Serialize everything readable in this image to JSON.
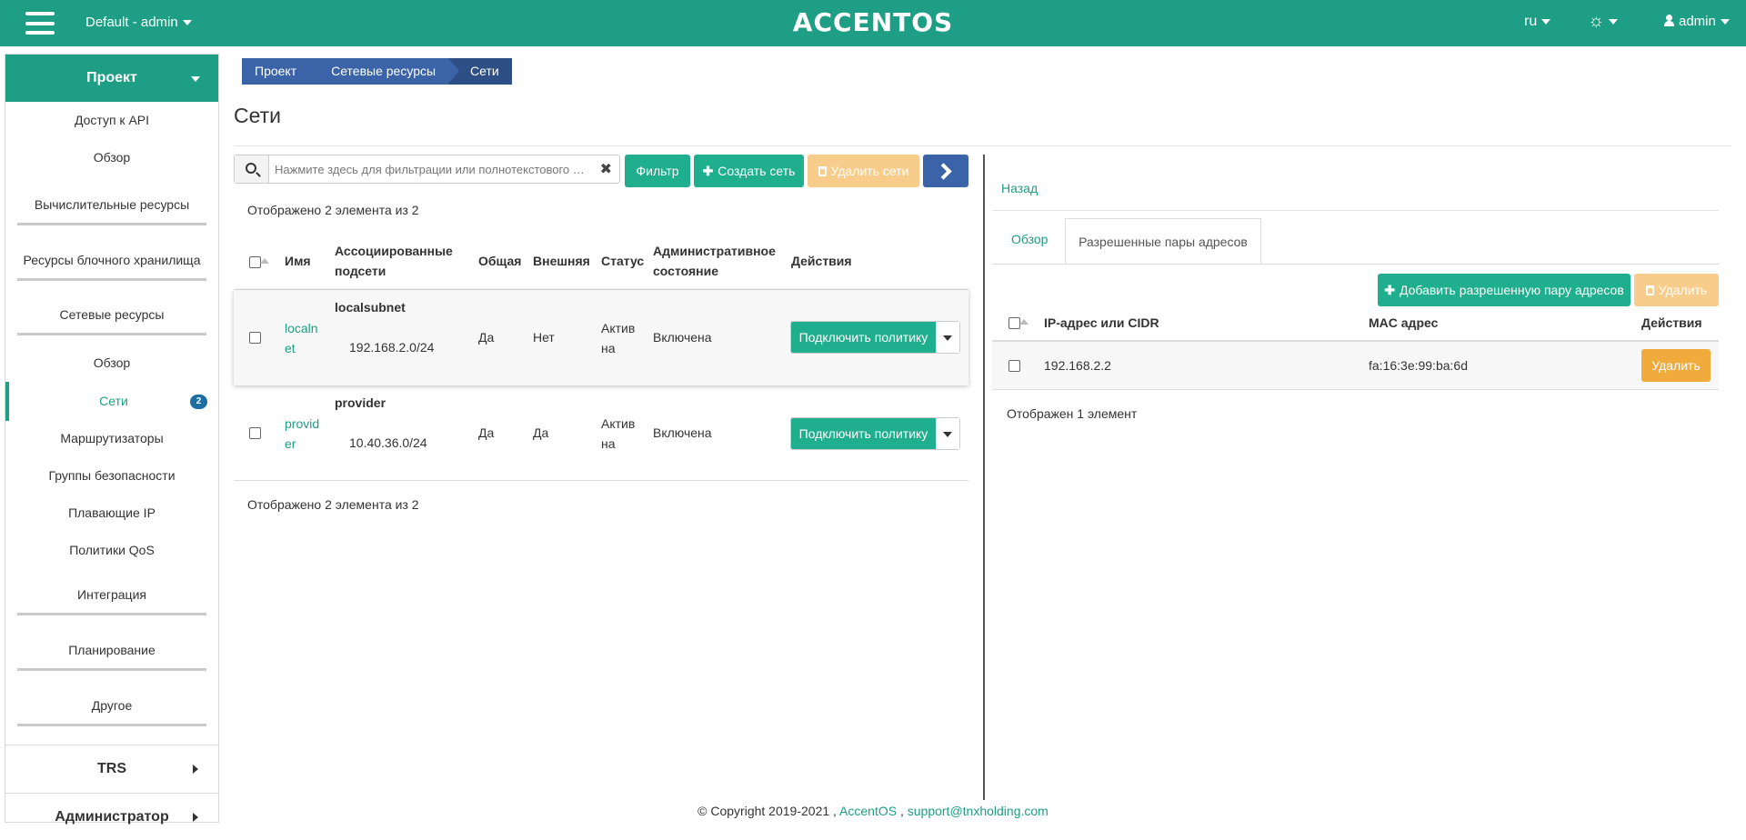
{
  "header": {
    "project_selector": "Default - admin",
    "logo": "ACCENTOS",
    "language": "ru",
    "gear_icon": "gear-icon",
    "user": "admin"
  },
  "sidebar": {
    "head": "Проект",
    "items": [
      {
        "label": "Доступ к API"
      },
      {
        "label": "Обзор"
      },
      {
        "label": "Вычислительные ресурсы"
      },
      {
        "label": "Ресурсы блочного хранилища"
      },
      {
        "label": "Сетевые ресурсы"
      },
      {
        "label": "Обзор"
      },
      {
        "label": "Сети",
        "badge": "2"
      },
      {
        "label": "Маршрутизаторы"
      },
      {
        "label": "Группы безопасности"
      },
      {
        "label": "Плавающие IP"
      },
      {
        "label": "Политики QoS"
      },
      {
        "label": "Интеграция"
      },
      {
        "label": "Планирование"
      },
      {
        "label": "Другое"
      }
    ],
    "bottom": [
      "TRS",
      "Администратор"
    ]
  },
  "breadcrumb": [
    "Проект",
    "Сетевые ресурсы",
    "Сети"
  ],
  "page_title": "Сети",
  "toolbar": {
    "search_placeholder": "Нажмите здесь для фильтрации или полнотекстового …",
    "filter_label": "Фильтр",
    "create_label": "Создать сеть",
    "delete_label": "Удалить сети"
  },
  "networks_table": {
    "count_text": "Отображено 2 элемента из 2",
    "columns": [
      "Имя",
      "Ассоциированные подсети",
      "Общая",
      "Внешняя",
      "Статус",
      "Административное состояние",
      "Действия"
    ],
    "rows": [
      {
        "name_l1": "localn",
        "name_l2": "et",
        "subnet_name": "localsubnet",
        "subnet_cidr": "192.168.2.0/24",
        "shared": "Да",
        "external": "Нет",
        "status_l1": "Актив",
        "status_l2": "на",
        "admin_state": "Включена",
        "action": "Подключить политику"
      },
      {
        "name_l1": "provid",
        "name_l2": "er",
        "subnet_name": "provider",
        "subnet_cidr": "10.40.36.0/24",
        "shared": "Да",
        "external": "Да",
        "status_l1": "Актив",
        "status_l2": "на",
        "admin_state": "Включена",
        "action": "Подключить политику"
      }
    ]
  },
  "detail": {
    "back_label": "Назад",
    "tabs": [
      "Обзор",
      "Разрешенные пары адресов"
    ],
    "add_label": "Добавить разрешенную пару адресов",
    "delete_label": "Удалить",
    "columns": [
      "IP-адрес или CIDR",
      "MAC адрес",
      "Действия"
    ],
    "rows": [
      {
        "ip": "192.168.2.2",
        "mac": "fa:16:3e:99:ba:6d",
        "action": "Удалить"
      }
    ],
    "count_text": "Отображен 1 элемент"
  },
  "footer": {
    "copyright": "© Copyright 2019-2021 ,",
    "brand_link": "AccentOS",
    "separator": ",",
    "email_link": "support@tnxholding.com"
  },
  "colors": {
    "accent": "#1e9e85",
    "primary_blue": "#3b63a8",
    "warning": "#f0ab3c",
    "badge": "#1c6ea4"
  }
}
